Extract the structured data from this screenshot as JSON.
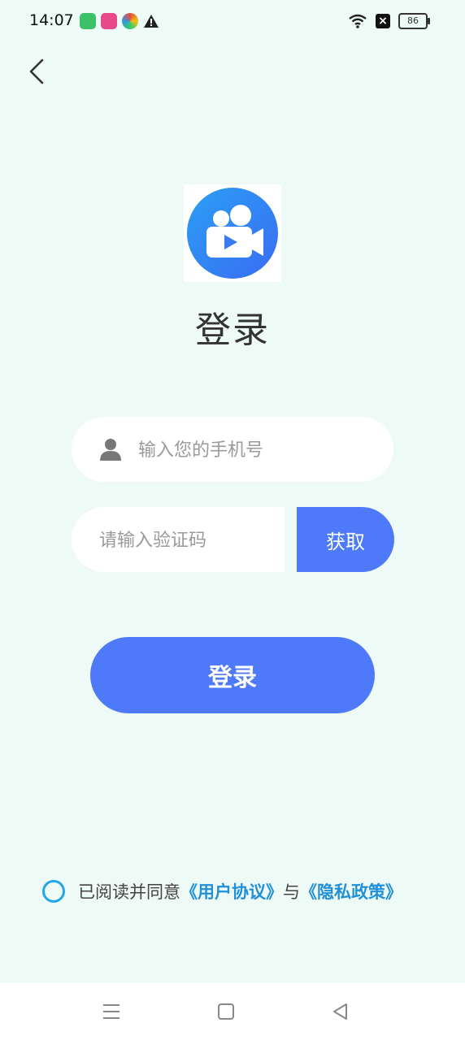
{
  "status_bar": {
    "time": "14:07",
    "battery": "86",
    "colors": {
      "app1": "#3cc06a",
      "app2": "#e64a8b",
      "app3": "#e8a726",
      "app4": "#222222"
    }
  },
  "header": {
    "back_icon": "chevron-left-icon"
  },
  "logo": {
    "icon": "video-camera-logo-icon"
  },
  "title": "登录",
  "phone": {
    "placeholder": "输入您的手机号",
    "icon": "user-icon"
  },
  "code": {
    "placeholder": "请输入验证码",
    "get_label": "获取"
  },
  "login_button": "登录",
  "agreement": {
    "prefix": "已阅读并同意",
    "user_agreement": "《用户协议》",
    "middle": "与",
    "privacy_policy": "《隐私政策》"
  },
  "colors": {
    "accent": "#4e7af9",
    "link": "#2190d8",
    "background": "#eefaf6"
  },
  "nav_bar": {
    "items": [
      "menu-icon",
      "home-square-icon",
      "back-triangle-icon"
    ]
  }
}
